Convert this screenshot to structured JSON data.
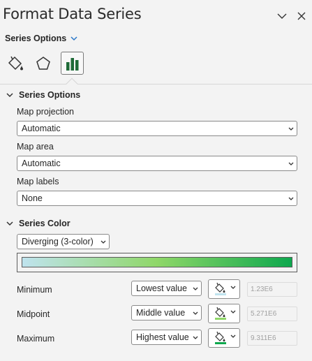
{
  "pane": {
    "title": "Format Data Series"
  },
  "series_options_dropdown": {
    "label": "Series Options"
  },
  "tabs": [
    {
      "name": "fill-line",
      "icon": "paint-bucket-icon"
    },
    {
      "name": "effects",
      "icon": "pentagon-icon"
    },
    {
      "name": "series-options",
      "icon": "bar-chart-icon",
      "active": true
    }
  ],
  "series_options": {
    "header": "Series Options",
    "map_projection": {
      "label": "Map projection",
      "value": "Automatic"
    },
    "map_area": {
      "label": "Map area",
      "value": "Automatic"
    },
    "map_labels": {
      "label": "Map labels",
      "value": "None"
    }
  },
  "series_color": {
    "header": "Series Color",
    "scheme": "Diverging (3-color)",
    "gradient": {
      "start": "#bfe3ee",
      "mid": "#8fd768",
      "end": "#0ea84e"
    },
    "rows": [
      {
        "label": "Minimum",
        "type": "Lowest value",
        "color": "#bfe3ee",
        "value": "1.23E6"
      },
      {
        "label": "Midpoint",
        "type": "Middle value",
        "color": "#8fd768",
        "value": "5.271E6"
      },
      {
        "label": "Maximum",
        "type": "Highest value",
        "color": "#0ea84e",
        "value": "9.311E6"
      }
    ]
  }
}
